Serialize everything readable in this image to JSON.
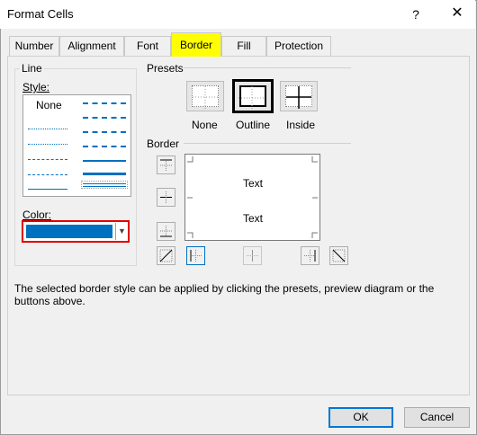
{
  "window": {
    "title": "Format Cells",
    "help_glyph": "?",
    "close_glyph": "✕"
  },
  "tabs": [
    {
      "label": "Number"
    },
    {
      "label": "Alignment"
    },
    {
      "label": "Font"
    },
    {
      "label": "Border",
      "active": true
    },
    {
      "label": "Fill"
    },
    {
      "label": "Protection"
    }
  ],
  "line_group": {
    "title": "Line",
    "style_label": "Style:",
    "style_none": "None",
    "color_label": "Color:",
    "color_value": "#0070c0"
  },
  "presets": {
    "title": "Presets",
    "items": [
      {
        "label": "None"
      },
      {
        "label": "Outline"
      },
      {
        "label": "Inside"
      }
    ]
  },
  "border": {
    "title": "Border",
    "preview_text_1": "Text",
    "preview_text_2": "Text"
  },
  "help_text": "The selected border style can be applied by clicking the presets, preview diagram or the buttons above.",
  "buttons": {
    "ok": "OK",
    "cancel": "Cancel"
  },
  "colors": {
    "accent": "#0070c0",
    "highlight": "#ffff00",
    "alert": "#e00000"
  }
}
